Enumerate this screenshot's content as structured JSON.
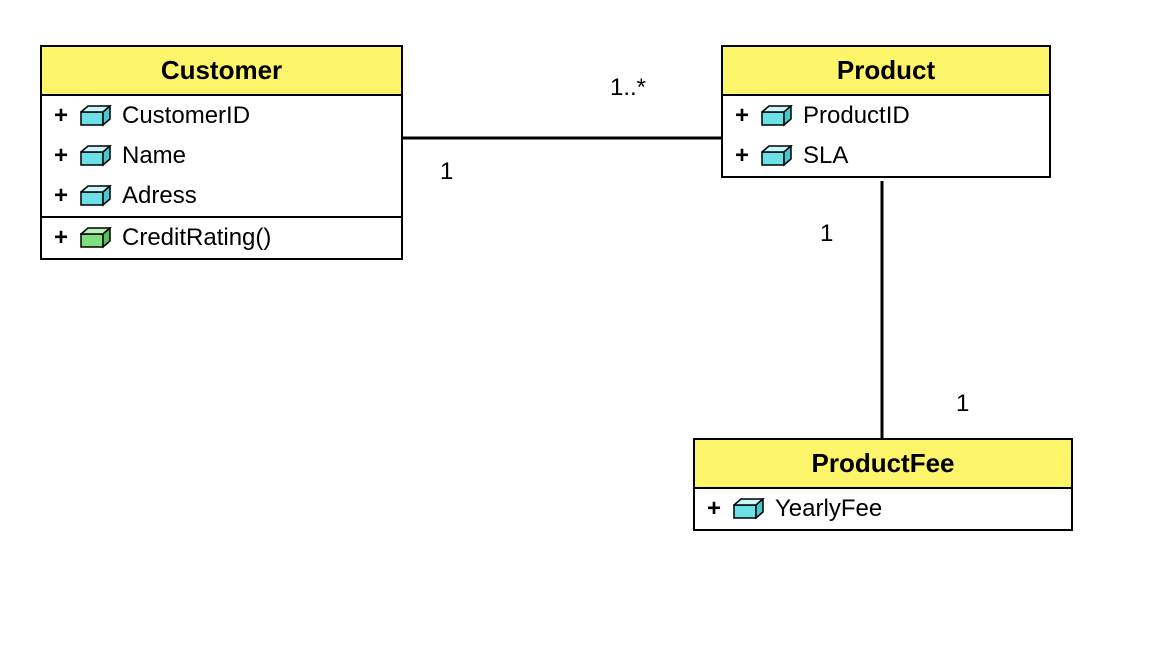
{
  "classes": {
    "customer": {
      "name": "Customer",
      "attributes": [
        {
          "visibility": "+",
          "name": "CustomerID",
          "iconColor": "#6be0e6"
        },
        {
          "visibility": "+",
          "name": "Name",
          "iconColor": "#6be0e6"
        },
        {
          "visibility": "+",
          "name": "Adress",
          "iconColor": "#6be0e6"
        }
      ],
      "operations": [
        {
          "visibility": "+",
          "name": "CreditRating()",
          "iconColor": "#7de07d"
        }
      ]
    },
    "product": {
      "name": "Product",
      "attributes": [
        {
          "visibility": "+",
          "name": "ProductID",
          "iconColor": "#6be0e6"
        },
        {
          "visibility": "+",
          "name": "SLA",
          "iconColor": "#6be0e6"
        }
      ]
    },
    "productFee": {
      "name": "ProductFee",
      "attributes": [
        {
          "visibility": "+",
          "name": "YearlyFee",
          "iconColor": "#6be0e6"
        }
      ]
    }
  },
  "multiplicities": {
    "customer_product_left": "1",
    "customer_product_right": "1..*",
    "product_fee_top": "1",
    "product_fee_bottom": "1"
  }
}
